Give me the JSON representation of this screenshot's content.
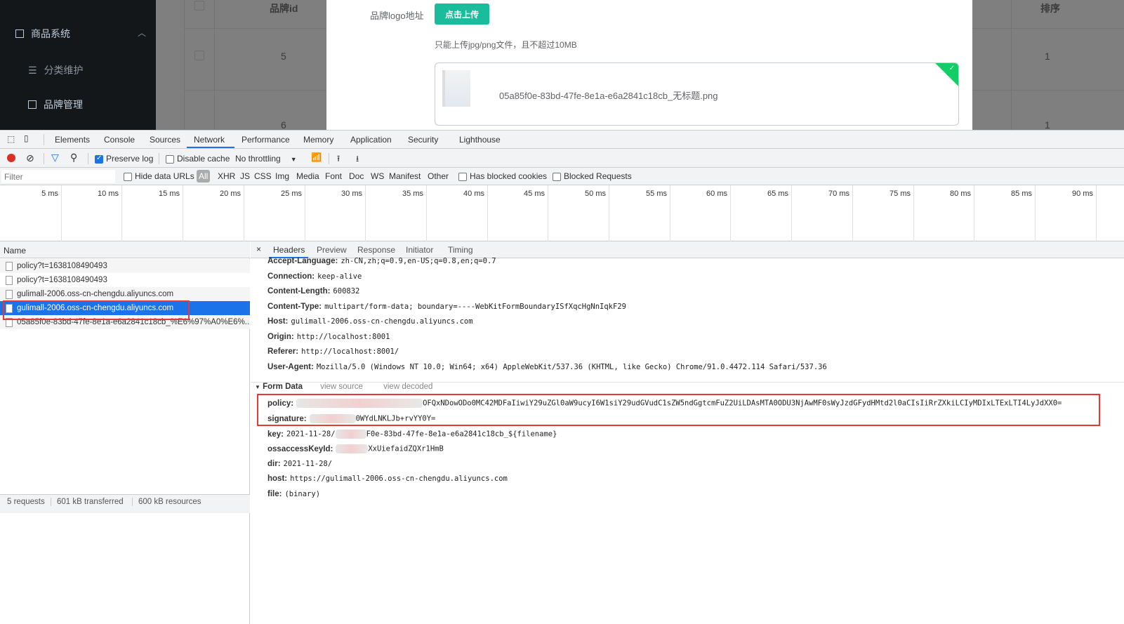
{
  "app": {
    "sidebar": {
      "group": "商品系统",
      "items": [
        {
          "label": "分类维护",
          "icon": "list-icon"
        },
        {
          "label": "品牌管理",
          "icon": "document-icon"
        }
      ]
    },
    "table": {
      "headers": [
        "品牌id",
        "排序"
      ],
      "rows": [
        {
          "id": "5",
          "sort": "1"
        },
        {
          "id": "6",
          "sort": "1"
        }
      ]
    },
    "dialog": {
      "logo_label": "品牌logo地址",
      "upload_button": "点击上传",
      "hint": "只能上传jpg/png文件，且不超过10MB",
      "file_name": "05a85f0e-83bd-47fe-8e1a-e6a2841c18cb_无标题.png",
      "upload_status": "success",
      "status_color": "#13ce66"
    }
  },
  "devtools": {
    "tabs": [
      "Elements",
      "Console",
      "Sources",
      "Network",
      "Performance",
      "Memory",
      "Application",
      "Security",
      "Lighthouse"
    ],
    "active_tab": "Network",
    "toolbar": {
      "preserve_log": "Preserve log",
      "preserve_log_checked": true,
      "disable_cache": "Disable cache",
      "disable_cache_checked": false,
      "throttling": "No throttling"
    },
    "filter": {
      "placeholder": "Filter",
      "hide_data_urls": "Hide data URLs",
      "types": [
        "All",
        "XHR",
        "JS",
        "CSS",
        "Img",
        "Media",
        "Font",
        "Doc",
        "WS",
        "Manifest",
        "Other"
      ],
      "has_blocked_cookies": "Has blocked cookies",
      "blocked_requests": "Blocked Requests"
    },
    "timeline_ticks": [
      "5 ms",
      "10 ms",
      "15 ms",
      "20 ms",
      "25 ms",
      "30 ms",
      "35 ms",
      "40 ms",
      "45 ms",
      "50 ms",
      "55 ms",
      "60 ms",
      "65 ms",
      "70 ms",
      "75 ms",
      "80 ms",
      "85 ms",
      "90 ms"
    ],
    "requests": {
      "header": "Name",
      "items": [
        "policy?t=1638108490493",
        "policy?t=1638108490493",
        "gulimall-2006.oss-cn-chengdu.aliyuncs.com",
        "gulimall-2006.oss-cn-chengdu.aliyuncs.com",
        "05a85f0e-83bd-47fe-8e1a-e6a2841c18cb_%E6%97%A0%E6%..."
      ],
      "selected": 3
    },
    "detail_tabs": [
      "Headers",
      "Preview",
      "Response",
      "Initiator",
      "Timing"
    ],
    "headers": [
      {
        "k": "Accept-Language:",
        "v": "zh-CN,zh;q=0.9,en-US;q=0.8,en;q=0.7"
      },
      {
        "k": "Connection:",
        "v": "keep-alive"
      },
      {
        "k": "Content-Length:",
        "v": "600832"
      },
      {
        "k": "Content-Type:",
        "v": "multipart/form-data; boundary=----WebKitFormBoundaryISfXqcHgNnIqkF29"
      },
      {
        "k": "Host:",
        "v": "gulimall-2006.oss-cn-chengdu.aliyuncs.com"
      },
      {
        "k": "Origin:",
        "v": "http://localhost:8001"
      },
      {
        "k": "Referer:",
        "v": "http://localhost:8001/"
      },
      {
        "k": "User-Agent:",
        "v": "Mozilla/5.0 (Windows NT 10.0; Win64; x64) AppleWebKit/537.36 (KHTML, like Gecko) Chrome/91.0.4472.114 Safari/537.36"
      }
    ],
    "form_data": {
      "title": "Form Data",
      "view_source": "view source",
      "view_decoded": "view decoded",
      "fields": [
        {
          "k": "policy:",
          "v": "OFQxNDowODo0MC42MDFaIiwiY29uZGl0aW9ucyI6W1siY29udGVudC1sZW5ndGgtcmFuZ2UiLDAsMTA0ODU3NjAwMF0sWyJzdGFydHMtd2l0aCIsIiRrZXkiLCIyMDIxLTExLTI4LyJdXX0="
        },
        {
          "k": "signature:",
          "v": "0WYdLNKLJb+rvYY0Y="
        },
        {
          "k": "key:",
          "v": "2021-11-28/",
          "v2": "F0e-83bd-47fe-8e1a-e6a2841c18cb_${filename}"
        },
        {
          "k": "ossaccessKeyId:",
          "v": "XxUiefaidZQXr1HmB"
        },
        {
          "k": "dir:",
          "v": "2021-11-28/"
        },
        {
          "k": "host:",
          "v": "https://gulimall-2006.oss-cn-chengdu.aliyuncs.com"
        },
        {
          "k": "file:",
          "v": "(binary)"
        }
      ]
    },
    "status": [
      "5 requests",
      "601 kB transferred",
      "600 kB resources"
    ],
    "highlight_color": "#e53935"
  }
}
